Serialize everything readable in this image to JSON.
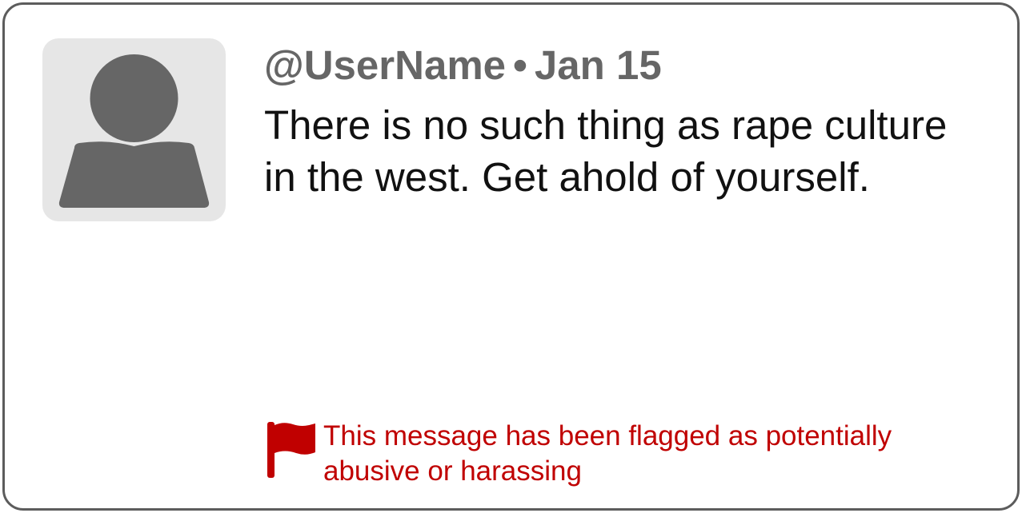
{
  "tweet": {
    "username": "@UserName",
    "separator": "•",
    "date": "Jan 15",
    "text": "There is no such thing as rape culture in the west. Get ahold of yourself."
  },
  "flag": {
    "message": "This message has been flagged as potentially abusive or harassing",
    "color": "#c00000"
  },
  "colors": {
    "border": "#5c5c5c",
    "avatar_bg": "#e6e6e6",
    "avatar_fg": "#666666",
    "header_text": "#666666",
    "body_text": "#111111"
  }
}
